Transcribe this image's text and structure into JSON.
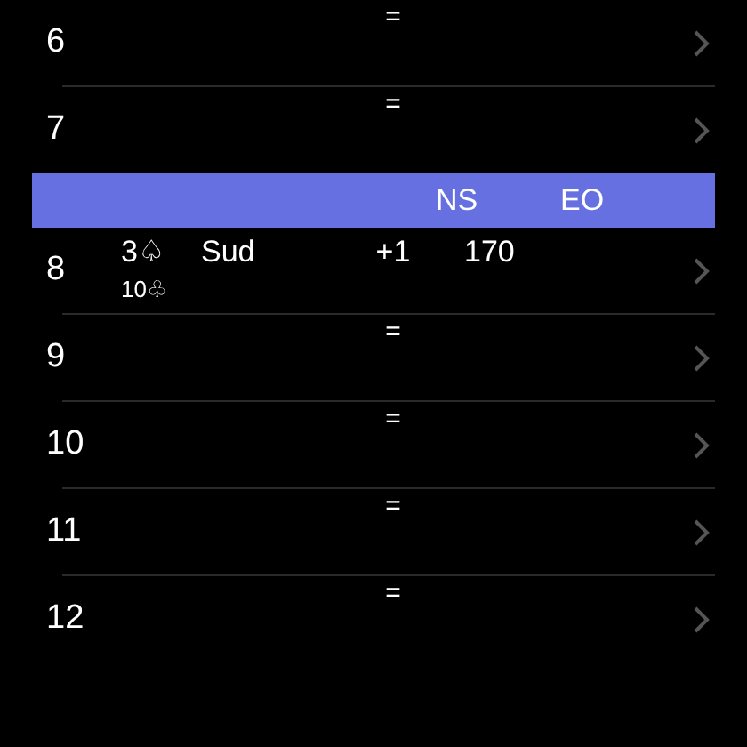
{
  "rows": [
    {
      "kind": "board",
      "number": "6",
      "result": "="
    },
    {
      "kind": "board",
      "number": "7",
      "result": "="
    },
    {
      "kind": "header",
      "ns": "NS",
      "eo": "EO"
    },
    {
      "kind": "board",
      "number": "8",
      "contract": "3♤",
      "lead": "10♧",
      "declarer": "Sud",
      "result": "+1",
      "ns": "170"
    },
    {
      "kind": "board",
      "number": "9",
      "result": "="
    },
    {
      "kind": "board",
      "number": "10",
      "result": "="
    },
    {
      "kind": "board",
      "number": "11",
      "result": "="
    },
    {
      "kind": "board",
      "number": "12",
      "result": "="
    }
  ]
}
